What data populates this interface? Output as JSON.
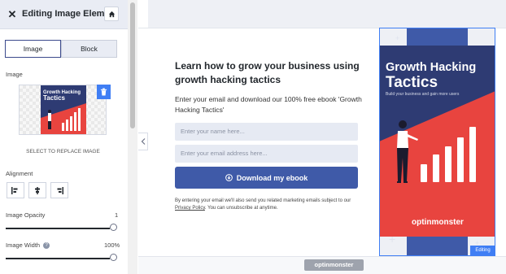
{
  "panel": {
    "title": "Editing Image Element",
    "tabs": [
      {
        "label": "Image"
      },
      {
        "label": "Block"
      }
    ],
    "image_label": "Image",
    "replace_text": "SELECT TO REPLACE IMAGE",
    "alignment_label": "Alignment",
    "opacity": {
      "label": "Image Opacity",
      "value": "1"
    },
    "width": {
      "label": "Image Width",
      "value": "100%"
    }
  },
  "preview": {
    "headline": "Learn how to grow your business using growth hacking tactics",
    "body": "Enter your email and download our 100% free ebook 'Growth Hacking Tactics'",
    "name_placeholder": "Enter your name here...",
    "email_placeholder": "Enter your email address here...",
    "cta_label": "Download my ebook",
    "disclaimer_pre": "By entering your email we'll also send you related marketing emails subject to our ",
    "disclaimer_link": "Privacy Policy",
    "disclaimer_post": ". You can unsubscribe at anytime.",
    "book": {
      "title_line1": "Growth Hacking",
      "title_line2": "Tactics",
      "subtitle": "Build your business and gain more users",
      "logo_text": "optinmonster"
    },
    "editing_badge": "Editing",
    "footer_logo": "optinmonster"
  },
  "colors": {
    "accent": "#3f5aa8",
    "selection": "#3f7ef4",
    "book_red": "#e8443f",
    "book_navy": "#2e3b73"
  }
}
